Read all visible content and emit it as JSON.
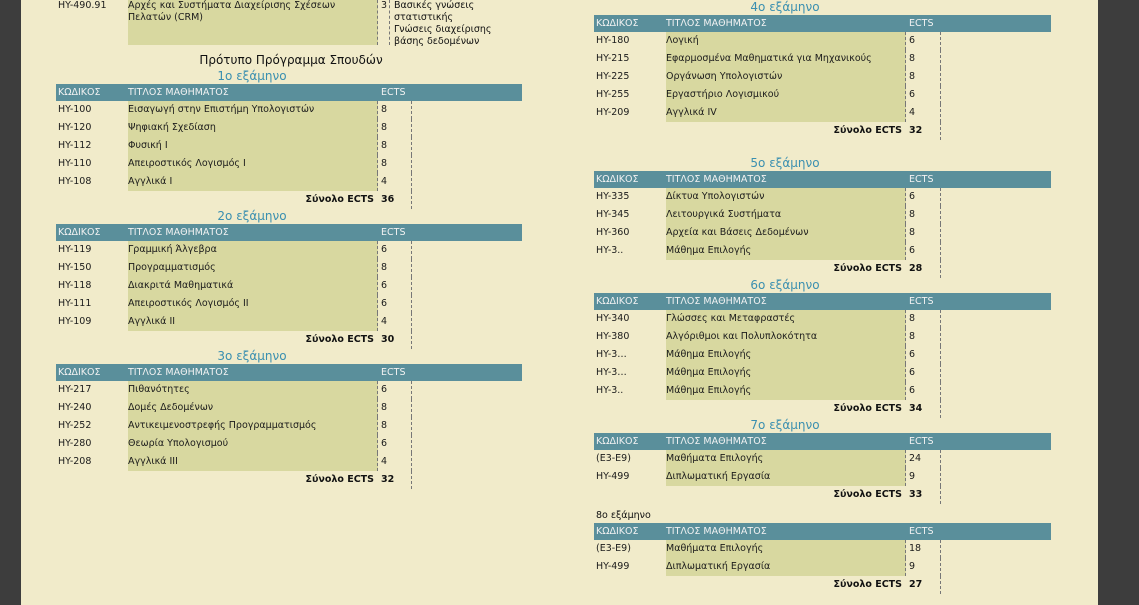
{
  "top": {
    "code": "HY-490.91",
    "title": "Αρχές και Συστήματα Διαχείρισης Σχέσεων Πελατών (CRM)",
    "ects": "3",
    "prereq_lines": [
      "Βασικές γνώσεις",
      "στατιστικής",
      "Γνώσεις διαχείρισης",
      "βάσης δεδομένων"
    ]
  },
  "program_title": "Πρότυπο Πρόγραμμα Σπουδών",
  "headers": {
    "code": "ΚΩΔΙΚΟΣ",
    "title": "ΤΙΤΛΟΣ ΜΑΘΗΜΑΤΟΣ",
    "ects": "ECTS"
  },
  "total_label": "Σύνολο ECTS",
  "semesters": [
    {
      "label": "1ο εξάμηνο",
      "total": "36",
      "courses": [
        {
          "code": "HY-100",
          "title": "Εισαγωγή στην Επιστήμη Υπολογιστών",
          "ects": "8"
        },
        {
          "code": "HY-120",
          "title": "Ψηφιακή Σχεδίαση",
          "ects": "8"
        },
        {
          "code": "HY-112",
          "title": "Φυσική Ι",
          "ects": "8"
        },
        {
          "code": "HY-110",
          "title": "Απειροστικός Λογισμός Ι",
          "ects": "8"
        },
        {
          "code": "HY-108",
          "title": "Αγγλικά Ι",
          "ects": "4"
        }
      ]
    },
    {
      "label": "2ο εξάμηνο",
      "total": "30",
      "courses": [
        {
          "code": "HY-119",
          "title": "Γραμμική Άλγεβρα",
          "ects": "6"
        },
        {
          "code": "HY-150",
          "title": "Προγραμματισμός",
          "ects": "8"
        },
        {
          "code": "HY-118",
          "title": "Διακριτά Μαθηματικά",
          "ects": "6"
        },
        {
          "code": "HY-111",
          "title": "Απειροστικός Λογισμός ΙΙ",
          "ects": "6"
        },
        {
          "code": "HY-109",
          "title": "Αγγλικά ΙΙ",
          "ects": "4"
        }
      ]
    },
    {
      "label": "3ο εξάμηνο",
      "total": "32",
      "courses": [
        {
          "code": "HY-217",
          "title": "Πιθανότητες",
          "ects": "6"
        },
        {
          "code": "HY-240",
          "title": "Δομές Δεδομένων",
          "ects": "8"
        },
        {
          "code": "HY-252",
          "title": "Αντικειμενοστρεφής Προγραμματισμός",
          "ects": "8"
        },
        {
          "code": "HY-280",
          "title": "Θεωρία Υπολογισμού",
          "ects": "6"
        },
        {
          "code": "HY-208",
          "title": "Αγγλικά ΙΙΙ",
          "ects": "4"
        }
      ]
    },
    {
      "label": "4ο εξάμηνο",
      "total": "32",
      "courses": [
        {
          "code": "HY-180",
          "title": "Λογική",
          "ects": "6"
        },
        {
          "code": "HY-215",
          "title": "Εφαρμοσμένα Μαθηματικά για Μηχανικούς",
          "ects": "8"
        },
        {
          "code": "HY-225",
          "title": "Οργάνωση Υπολογιστών",
          "ects": "8"
        },
        {
          "code": "HY-255",
          "title": "Εργαστήριο Λογισμικού",
          "ects": "6"
        },
        {
          "code": "HY-209",
          "title": "Αγγλικά IV",
          "ects": "4"
        }
      ]
    },
    {
      "label": "5ο εξάμηνο",
      "total": "28",
      "courses": [
        {
          "code": "HY-335",
          "title": "Δίκτυα Υπολογιστών",
          "ects": "6"
        },
        {
          "code": "HY-345",
          "title": "Λειτουργικά Συστήματα",
          "ects": "8"
        },
        {
          "code": "HY-360",
          "title": "Αρχεία και Βάσεις Δεδομένων",
          "ects": "8"
        },
        {
          "code": "HY-3..",
          "title": "Μάθημα Επιλογής",
          "ects": "6"
        }
      ]
    },
    {
      "label": "6ο εξάμηνο",
      "total": "34",
      "courses": [
        {
          "code": "HY-340",
          "title": "Γλώσσες και Μεταφραστές",
          "ects": "8"
        },
        {
          "code": "HY-380",
          "title": "Αλγόριθμοι και Πολυπλοκότητα",
          "ects": "8"
        },
        {
          "code": "HY-3…",
          "title": "Μάθημα Επιλογής",
          "ects": "6"
        },
        {
          "code": "HY-3…",
          "title": "Μάθημα Επιλογής",
          "ects": "6"
        },
        {
          "code": "HY-3..",
          "title": "Μάθημα Επιλογής",
          "ects": "6"
        }
      ]
    },
    {
      "label": "7ο εξάμηνο",
      "total": "33",
      "courses": [
        {
          "code": "(Ε3-Ε9)",
          "title": "Μαθήματα Επιλογής",
          "ects": "24"
        },
        {
          "code": "HY-499",
          "title": "Διπλωματική Εργασία",
          "ects": "9"
        }
      ]
    },
    {
      "label": "8ο εξάμηνο",
      "total": "27",
      "courses": [
        {
          "code": "(Ε3-Ε9)",
          "title": "Μαθήματα Επιλογής",
          "ects": "18"
        },
        {
          "code": "HY-499",
          "title": "Διπλωματική Εργασία",
          "ects": "9"
        }
      ]
    }
  ]
}
